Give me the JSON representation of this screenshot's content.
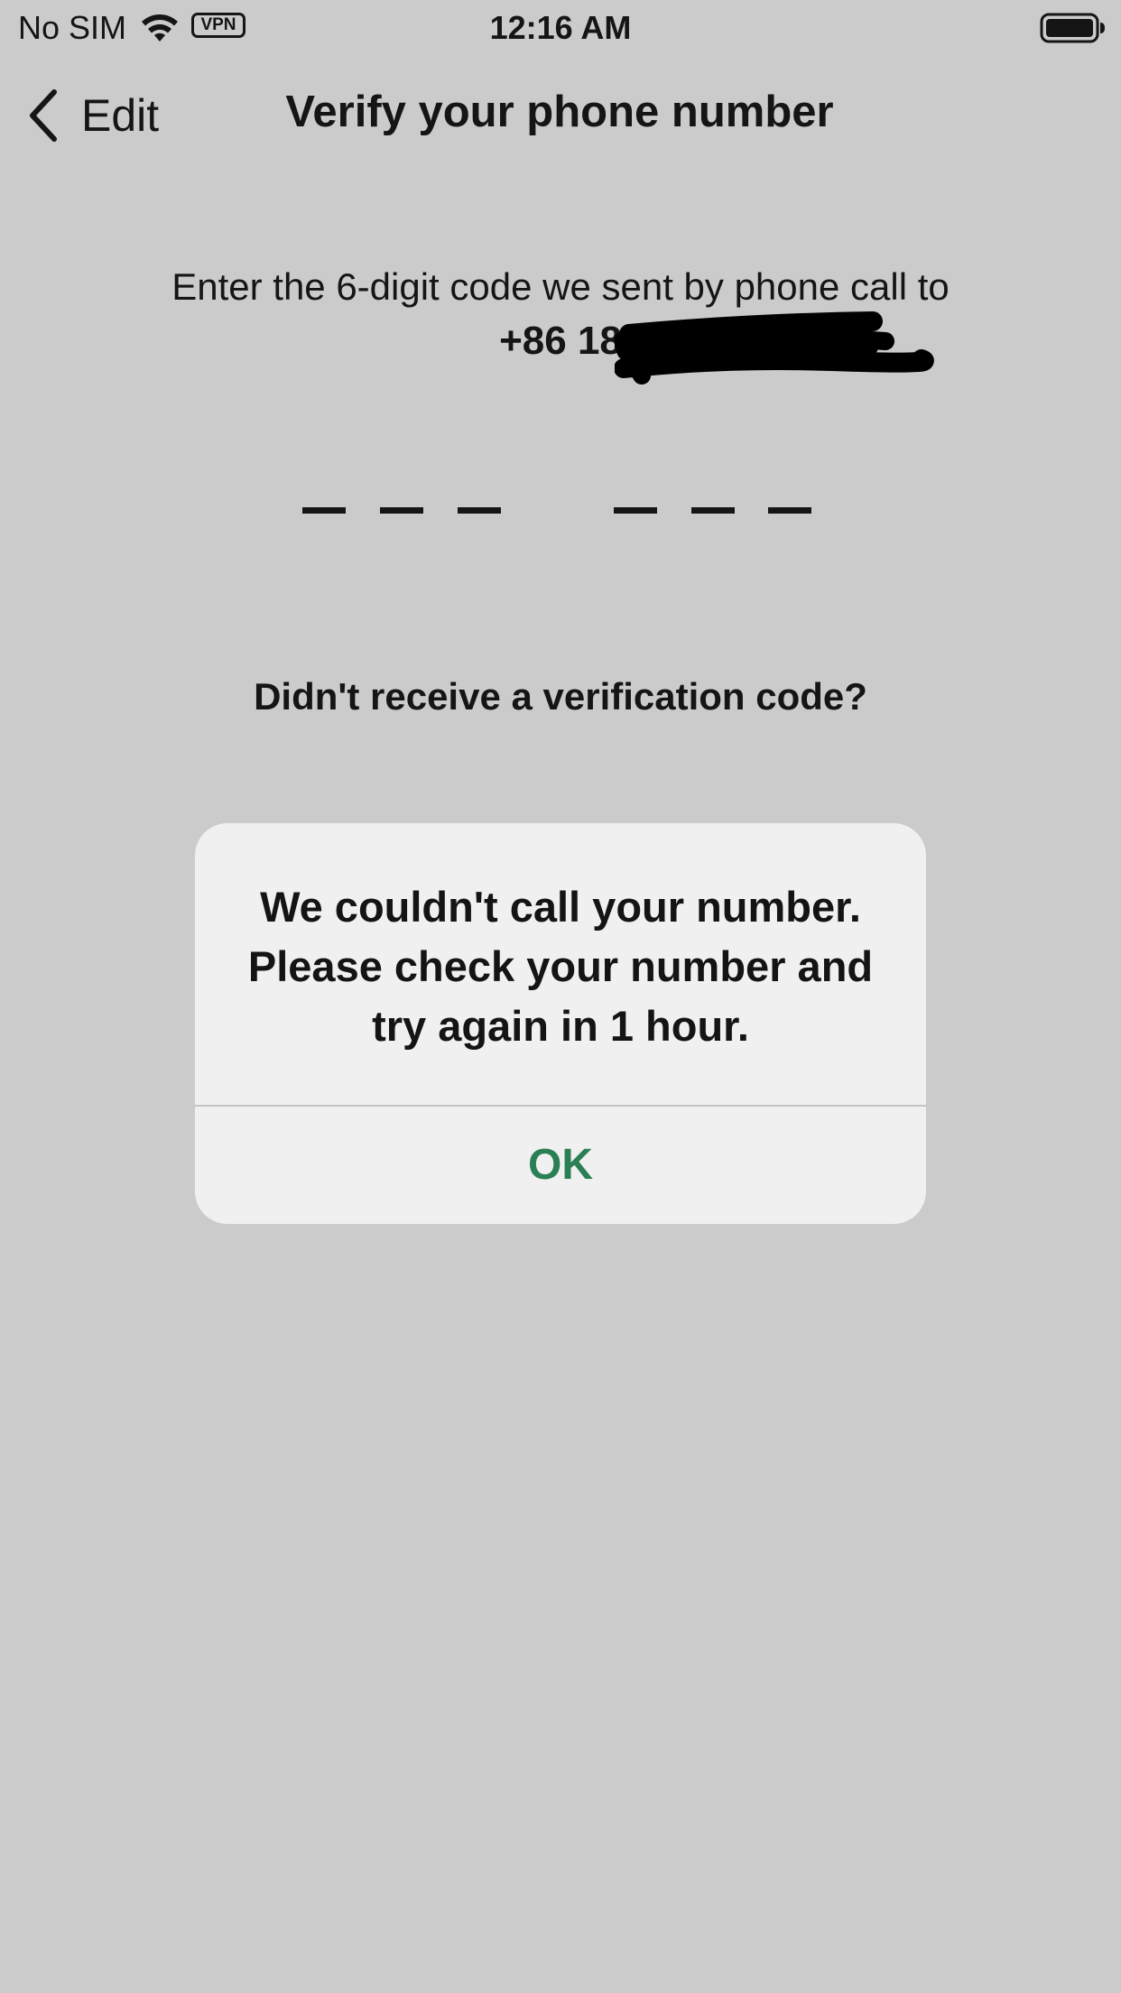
{
  "status_bar": {
    "carrier": "No SIM",
    "vpn": "VPN",
    "time": "12:16 AM",
    "wifi_icon": "wifi-icon",
    "battery_icon": "battery-icon"
  },
  "nav": {
    "back_label": "Edit",
    "title": "Verify your phone number"
  },
  "instructions": {
    "text": "Enter the 6-digit code we sent by phone call to",
    "phone_visible": "+86 18",
    "phone_redacted": true
  },
  "code_input": {
    "length": 6,
    "groups": 2,
    "entered": ""
  },
  "resend_link": "Didn't receive a verification code?",
  "alert": {
    "message": "We couldn't call your number. Please check your number and try again in 1 hour.",
    "ok_label": "OK",
    "ok_color": "#2a7f55"
  },
  "colors": {
    "background": "#cbcbcb",
    "alert_background": "#f0f0f0",
    "text": "#151515"
  }
}
